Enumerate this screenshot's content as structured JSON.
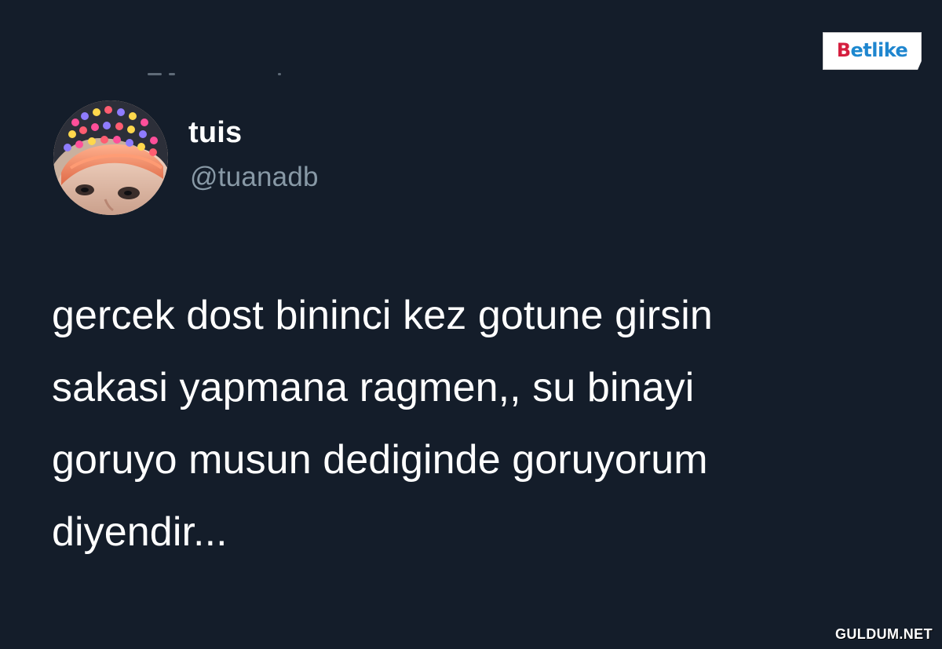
{
  "post": {
    "display_name": "tuis",
    "handle": "@tuanadb",
    "text_lines": [
      "gercek dost bininci kez gotune girsin",
      "sakasi yapmana ragmen,, su binayi",
      "goruyo musun dediginde goruyorum",
      "diyendir..."
    ]
  },
  "brand": {
    "logo": "Betlike",
    "watermark": "GULDUM.NET"
  },
  "colors": {
    "background": "#141d2a",
    "text_primary": "#ffffff",
    "text_secondary": "#8899a6"
  },
  "icons": {
    "avatar": "profile-avatar-icon"
  }
}
